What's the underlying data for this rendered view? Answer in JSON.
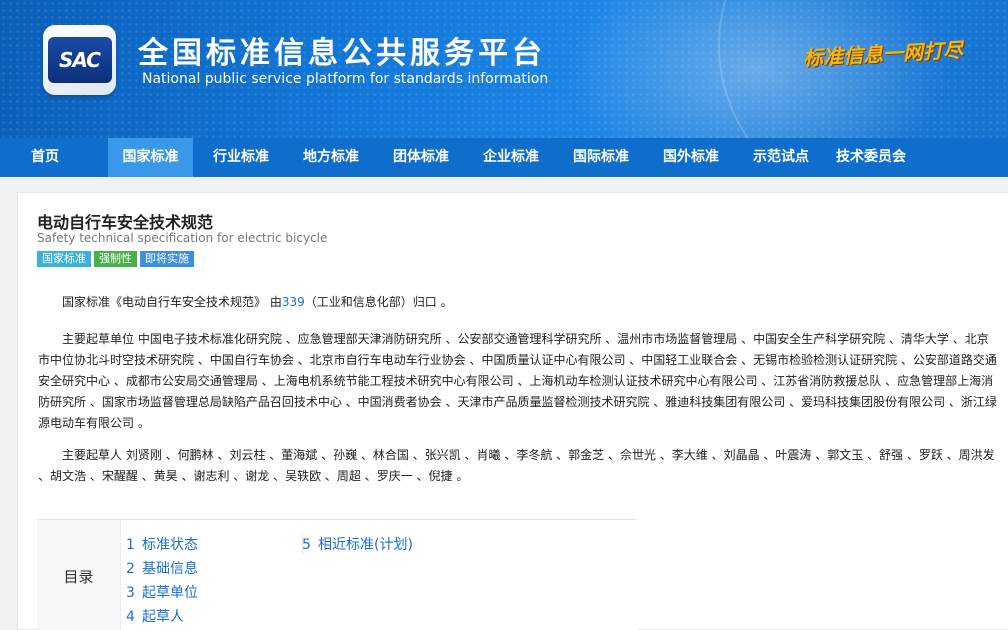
{
  "header": {
    "logo_text": "SAC",
    "title": "全国标准信息公共服务平台",
    "subtitle": "National public service platform  for standards information",
    "slogan": "标准信息一网打尽"
  },
  "nav": {
    "items": [
      {
        "label": "首页",
        "active": false
      },
      {
        "label": "国家标准",
        "active": true
      },
      {
        "label": "行业标准",
        "active": false
      },
      {
        "label": "地方标准",
        "active": false
      },
      {
        "label": "团体标准",
        "active": false
      },
      {
        "label": "企业标准",
        "active": false
      },
      {
        "label": "国际标准",
        "active": false
      },
      {
        "label": "国外标准",
        "active": false
      },
      {
        "label": "示范试点",
        "active": false
      },
      {
        "label": "技术委员会",
        "active": false
      }
    ]
  },
  "standard": {
    "title": "电动自行车安全技术规范",
    "title_en": "Safety technical specification for electric bicycle",
    "tags": [
      {
        "label": "国家标准",
        "color": "#3bb3d8"
      },
      {
        "label": "强制性",
        "color": "#46b04a"
      },
      {
        "label": "即将实施",
        "color": "#3f8fe0"
      }
    ],
    "intro_prefix": "国家标准《电动自行车安全技术规范》 由",
    "intro_link": "339",
    "intro_suffix": "（工业和信息化部）归口 。",
    "drafting_units": "主要起草单位 中国电子技术标准化研究院 、应急管理部天津消防研究所 、公安部交通管理科学研究所 、温州市市场监督管理局 、中国安全生产科学研究院 、清华大学 、北京市中位协北斗时空技术研究院 、中国自行车协会 、北京市自行车电动车行业协会 、中国质量认证中心有限公司 、中国轻工业联合会 、无锡市检验检测认证研究院 、公安部道路交通安全研究中心 、成都市公安局交通管理局 、上海电机系统节能工程技术研究中心有限公司 、上海机动车检测认证技术研究中心有限公司 、江苏省消防救援总队 、应急管理部上海消防研究所 、国家市场监督管理总局缺陷产品召回技术中心 、中国消费者协会 、天津市产品质量监督检测技术研究院 、雅迪科技集团有限公司 、爱玛科技集团股份有限公司 、浙江绿源电动车有限公司 。",
    "drafters": "主要起草人 刘贤刚 、何鹏林 、刘云柱 、董海斌 、孙巍 、林合国 、张兴凯 、肖曦 、李冬航 、郭金芝 、佘世光 、李大维 、刘晶晶 、叶震涛 、郭文玉 、舒强 、罗跃 、周洪发 、胡文浩 、宋醒醒 、黄昊 、谢志利 、谢龙 、吴轶欧 、周超 、罗庆一 、倪捷 。"
  },
  "toc": {
    "label": "目录",
    "left": [
      {
        "num": "1",
        "label": "标准状态"
      },
      {
        "num": "2",
        "label": "基础信息"
      },
      {
        "num": "3",
        "label": "起草单位"
      },
      {
        "num": "4",
        "label": "起草人"
      }
    ],
    "right": [
      {
        "num": "5",
        "label": "相近标准(计划)"
      }
    ]
  }
}
